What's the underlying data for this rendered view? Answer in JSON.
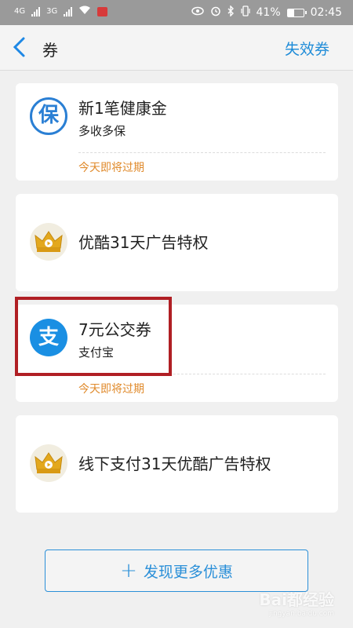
{
  "status_bar": {
    "network_1": "4G",
    "network_2": "3G",
    "battery": "41%",
    "time": "02:45",
    "icons": [
      "signal-icon",
      "wifi-icon",
      "huawei-icon",
      "eye-icon",
      "alarm-icon",
      "bluetooth-icon",
      "vibrate-icon",
      "battery-icon"
    ]
  },
  "header": {
    "title": "券",
    "right_link": "失效券",
    "accent": "#1e88e5"
  },
  "coupons": [
    {
      "icon": "baoxian-icon",
      "logo_char": "保",
      "name": "新1笔健康金",
      "subtitle": "多收多保",
      "expire": "今天即将过期"
    },
    {
      "icon": "youku-crown-icon",
      "name": "优酷31天广告特权"
    },
    {
      "icon": "alipay-icon",
      "logo_char": "支",
      "name": "7元公交券",
      "subtitle": "支付宝",
      "expire": "今天即将过期",
      "highlighted": true
    },
    {
      "icon": "youku-crown-icon",
      "name": "线下支付31天优酷广告特权"
    }
  ],
  "discover_button": {
    "label": "发现更多优惠",
    "icon": "plus-icon"
  },
  "watermark": {
    "text": "Bai都经验",
    "sub": "jingyan.baidu.com"
  },
  "colors": {
    "expire": "#e08a2b",
    "highlight_border": "#b01f24",
    "alipay": "#1a8fe3"
  }
}
